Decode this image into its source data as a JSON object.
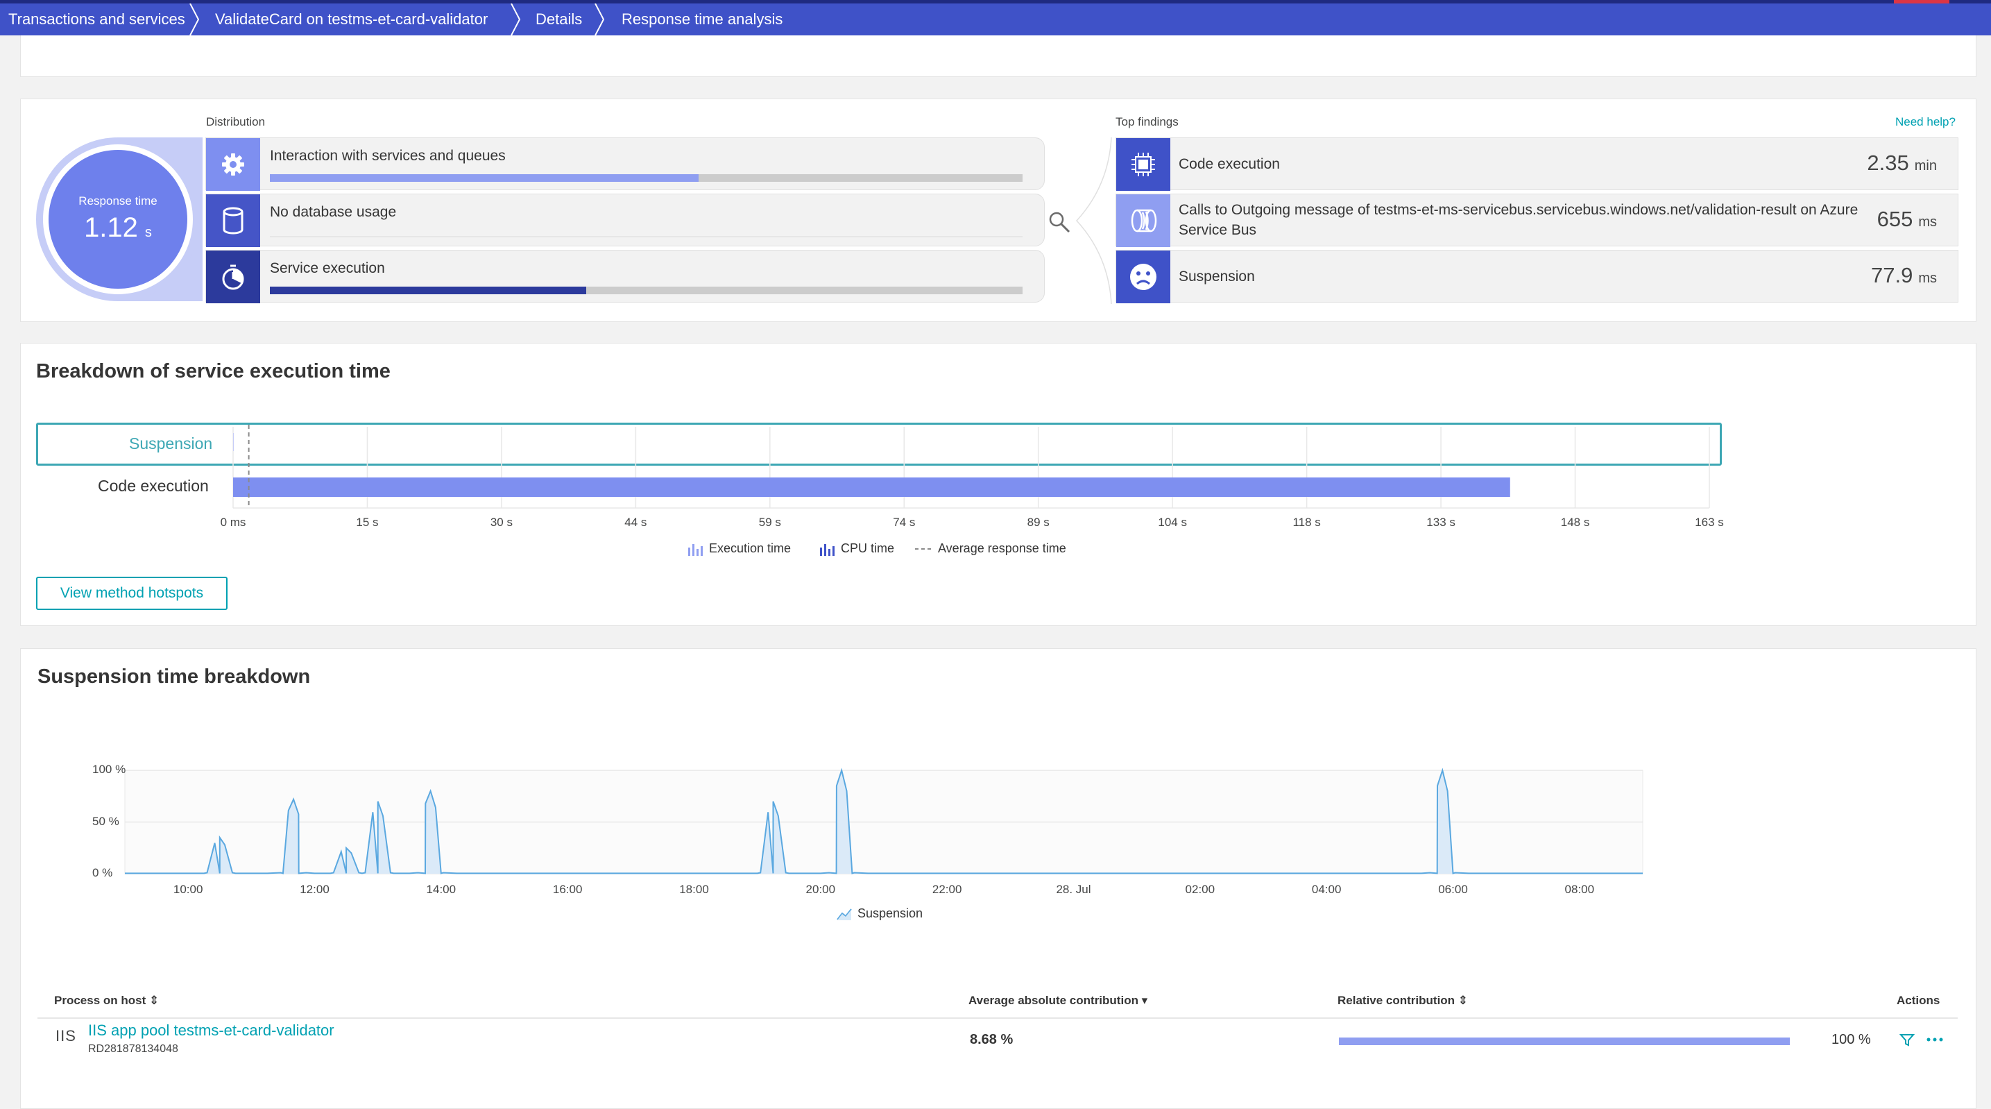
{
  "breadcrumb": [
    "Transactions and services",
    "ValidateCard on testms-et-card-validator",
    "Details",
    "Response time analysis"
  ],
  "response_time": {
    "label": "Response time",
    "value": "1.12",
    "unit": "s"
  },
  "distribution": {
    "heading": "Distribution",
    "items": [
      {
        "label": "Interaction with services and queues",
        "icon": "gear-icon",
        "share": 0.57,
        "color": "#8f9ef1"
      },
      {
        "label": "No database usage",
        "icon": "database-icon",
        "share": 0,
        "color": "#4555c7"
      },
      {
        "label": "Service execution",
        "icon": "stopwatch-icon",
        "share": 0.42,
        "color": "#2c3a9c"
      }
    ]
  },
  "top_findings": {
    "heading": "Top findings",
    "help": "Need help?",
    "items": [
      {
        "label": "Code execution",
        "value": "2.35",
        "unit": "min",
        "icon": "cpu-icon"
      },
      {
        "label": "Calls to Outgoing message of testms-et-ms-servicebus.servicebus.windows.net/validation-result on Azure Service Bus",
        "value": "655",
        "unit": "ms",
        "icon": "queue-icon"
      },
      {
        "label": "Suspension",
        "value": "77.9",
        "unit": "ms",
        "icon": "sad-face-icon"
      }
    ]
  },
  "breakdown": {
    "title": "Breakdown of service execution time",
    "rows": [
      "Suspension",
      "Code execution"
    ],
    "ticks": [
      "0 ms",
      "15 s",
      "30 s",
      "44 s",
      "59 s",
      "74 s",
      "89 s",
      "104 s",
      "118 s",
      "133 s",
      "148 s",
      "163 s"
    ],
    "legend": [
      "Execution time",
      "CPU time",
      "Average response time"
    ],
    "button": "View method hotspots"
  },
  "suspension": {
    "title": "Suspension time breakdown",
    "y_ticks": [
      "100 %",
      "50 %",
      "0 %"
    ],
    "x_ticks": [
      "10:00",
      "12:00",
      "14:00",
      "16:00",
      "18:00",
      "20:00",
      "22:00",
      "28. Jul",
      "02:00",
      "04:00",
      "06:00",
      "08:00"
    ],
    "legend": "Suspension",
    "table": {
      "headers": {
        "process": "Process on host ⇕",
        "avg": "Average absolute contribution ▾",
        "rel": "Relative contribution ⇕",
        "actions": "Actions"
      },
      "row": {
        "icon_text": "IIS",
        "name": "IIS app pool testms-et-card-validator",
        "host": "RD281878134048",
        "avg": "8.68 %",
        "rel_pct": "100 %",
        "rel_fraction": 1.0
      }
    }
  },
  "chart_data": [
    {
      "type": "bar",
      "title": "Breakdown of service execution time",
      "categories": [
        "Suspension",
        "Code execution"
      ],
      "series": [
        {
          "name": "Execution time",
          "values": [
            0.078,
            141
          ]
        }
      ],
      "xlabel": "",
      "ylabel": "",
      "x_unit": "s",
      "xlim": [
        0,
        163
      ],
      "avg_response_time": 1.12,
      "legend": [
        "Execution time",
        "CPU time",
        "Average response time"
      ]
    },
    {
      "type": "area",
      "title": "Suspension time breakdown",
      "x": [
        "09:00",
        "09:15",
        "09:30",
        "09:45",
        "10:00",
        "10:15",
        "10:30",
        "10:45",
        "11:00",
        "11:15",
        "11:30",
        "11:45",
        "12:00",
        "12:15",
        "12:30",
        "12:45",
        "13:00",
        "13:15",
        "13:30",
        "13:45",
        "14:00",
        "14:15",
        "14:30",
        "15:00",
        "16:00",
        "17:00",
        "18:00",
        "18:30",
        "19:00",
        "19:15",
        "19:30",
        "19:45",
        "20:00",
        "20:15",
        "20:30",
        "20:45",
        "21:00",
        "21:15",
        "21:30",
        "22:00",
        "23:00",
        "00:00",
        "01:00",
        "02:00",
        "03:00",
        "04:00",
        "05:00",
        "05:15",
        "05:30",
        "05:45",
        "06:00",
        "06:15",
        "06:30",
        "07:00",
        "08:00",
        "09:00"
      ],
      "series": [
        {
          "name": "Suspension",
          "values": [
            0,
            0,
            0,
            0,
            0,
            0,
            5,
            35,
            0,
            0,
            0,
            0,
            72,
            25,
            0,
            0,
            25,
            0,
            70,
            0,
            0,
            0,
            0,
            0,
            0,
            0,
            0,
            0,
            0,
            0,
            0,
            0,
            0,
            0,
            0,
            0,
            0,
            0,
            0,
            0,
            0,
            0,
            0,
            0,
            0,
            0,
            0,
            0,
            0,
            0,
            0,
            0,
            0,
            0,
            0,
            0
          ]
        }
      ],
      "peaks": [
        {
          "x": "10:30",
          "value": 35
        },
        {
          "x": "11:40",
          "value": 72
        },
        {
          "x": "12:30",
          "value": 25
        },
        {
          "x": "13:00",
          "value": 70
        },
        {
          "x": "13:50",
          "value": 80
        },
        {
          "x": "19:15",
          "value": 70
        },
        {
          "x": "20:20",
          "value": 100
        },
        {
          "x": "05:50",
          "value": 100
        }
      ],
      "ylim": [
        0,
        100
      ],
      "y_unit": "%",
      "legend": [
        "Suspension"
      ]
    }
  ]
}
